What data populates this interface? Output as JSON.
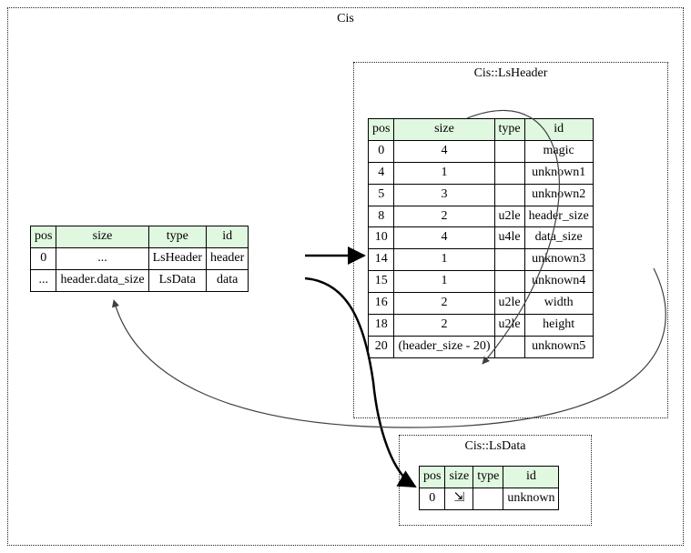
{
  "clusters": {
    "outer": {
      "label": "Cis"
    },
    "header": {
      "label": "Cis::LsHeader"
    },
    "data": {
      "label": "Cis::LsData"
    }
  },
  "columns": {
    "pos": "pos",
    "size": "size",
    "type": "type",
    "id": "id"
  },
  "main_table": {
    "rows": [
      {
        "pos": "0",
        "size": "...",
        "type": "LsHeader",
        "id": "header"
      },
      {
        "pos": "...",
        "size": "header.data_size",
        "type": "LsData",
        "id": "data"
      }
    ]
  },
  "header_table": {
    "rows": [
      {
        "pos": "0",
        "size": "4",
        "type": "",
        "id": "magic"
      },
      {
        "pos": "4",
        "size": "1",
        "type": "",
        "id": "unknown1"
      },
      {
        "pos": "5",
        "size": "3",
        "type": "",
        "id": "unknown2"
      },
      {
        "pos": "8",
        "size": "2",
        "type": "u2le",
        "id": "header_size"
      },
      {
        "pos": "10",
        "size": "4",
        "type": "u4le",
        "id": "data_size"
      },
      {
        "pos": "14",
        "size": "1",
        "type": "",
        "id": "unknown3"
      },
      {
        "pos": "15",
        "size": "1",
        "type": "",
        "id": "unknown4"
      },
      {
        "pos": "16",
        "size": "2",
        "type": "u2le",
        "id": "width"
      },
      {
        "pos": "18",
        "size": "2",
        "type": "u2le",
        "id": "height"
      },
      {
        "pos": "20",
        "size": "(header_size - 20)",
        "type": "",
        "id": "unknown5"
      }
    ]
  },
  "data_table": {
    "rows": [
      {
        "pos": "0",
        "size": "⇲",
        "type": "",
        "id": "unknown"
      }
    ]
  }
}
